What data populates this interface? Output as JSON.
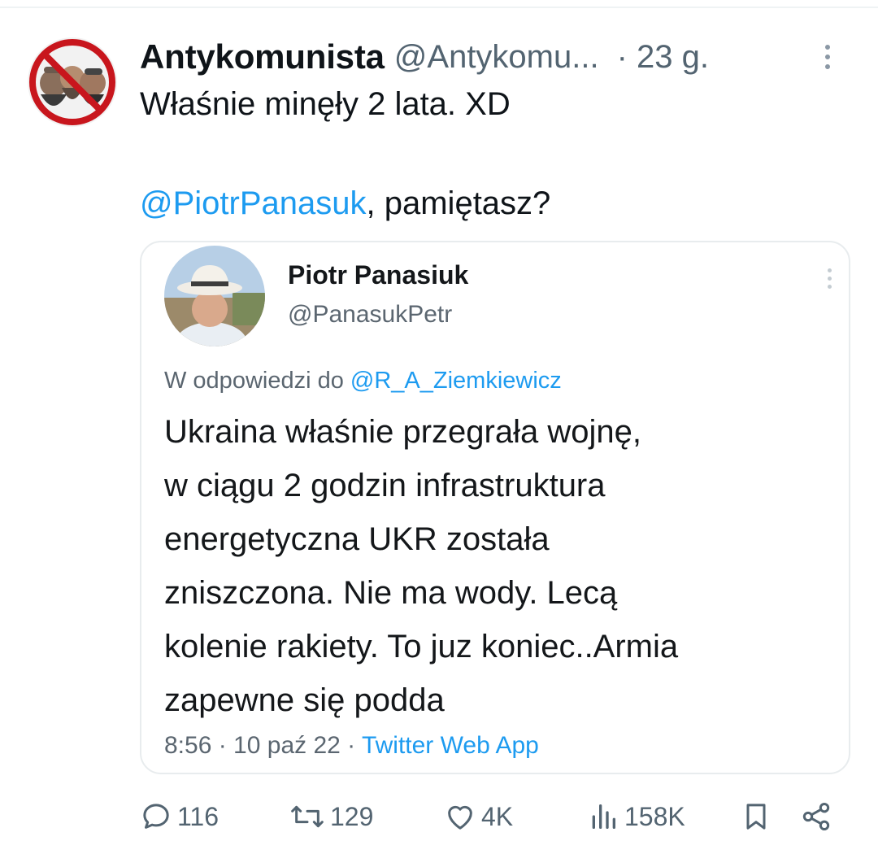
{
  "tweet": {
    "display_name": "Antykomunista",
    "handle": "@Antykomu...",
    "time": "· 23 g.",
    "text": "Właśnie minęły 2 lata. XD",
    "mention": "@PiotrPanasuk",
    "mention_suffix": ", pamiętasz?"
  },
  "quoted": {
    "name": "Piotr Panasiuk",
    "handle": "@PanasukPetr",
    "reply_prefix": "W odpowiedzi do ",
    "reply_mention": "@R_A_Ziemkiewicz",
    "body_lines": [
      "Ukraina właśnie przegrała wojnę,",
      "w ciągu 2 godzin infrastruktura",
      "energetyczna UKR została",
      "zniszczona. Nie ma wody. Lecą",
      "kolenie rakiety. To juz koniec..Armia",
      "zapewne się podda"
    ],
    "meta_time": "8:56 · 10 paź 22 · ",
    "meta_app": "Twitter Web App"
  },
  "actions": {
    "replies": "116",
    "reposts": "129",
    "likes": "4K",
    "views": "158K"
  },
  "icons": {
    "reply": "reply-icon",
    "repost": "repost-icon",
    "like": "like-icon",
    "views": "views-icon",
    "bookmark": "bookmark-icon",
    "share": "share-icon",
    "more": "more-options-icon"
  },
  "colors": {
    "accent": "#1d9bf0",
    "secondary_text": "#536471",
    "primary_text": "#0f1419"
  }
}
